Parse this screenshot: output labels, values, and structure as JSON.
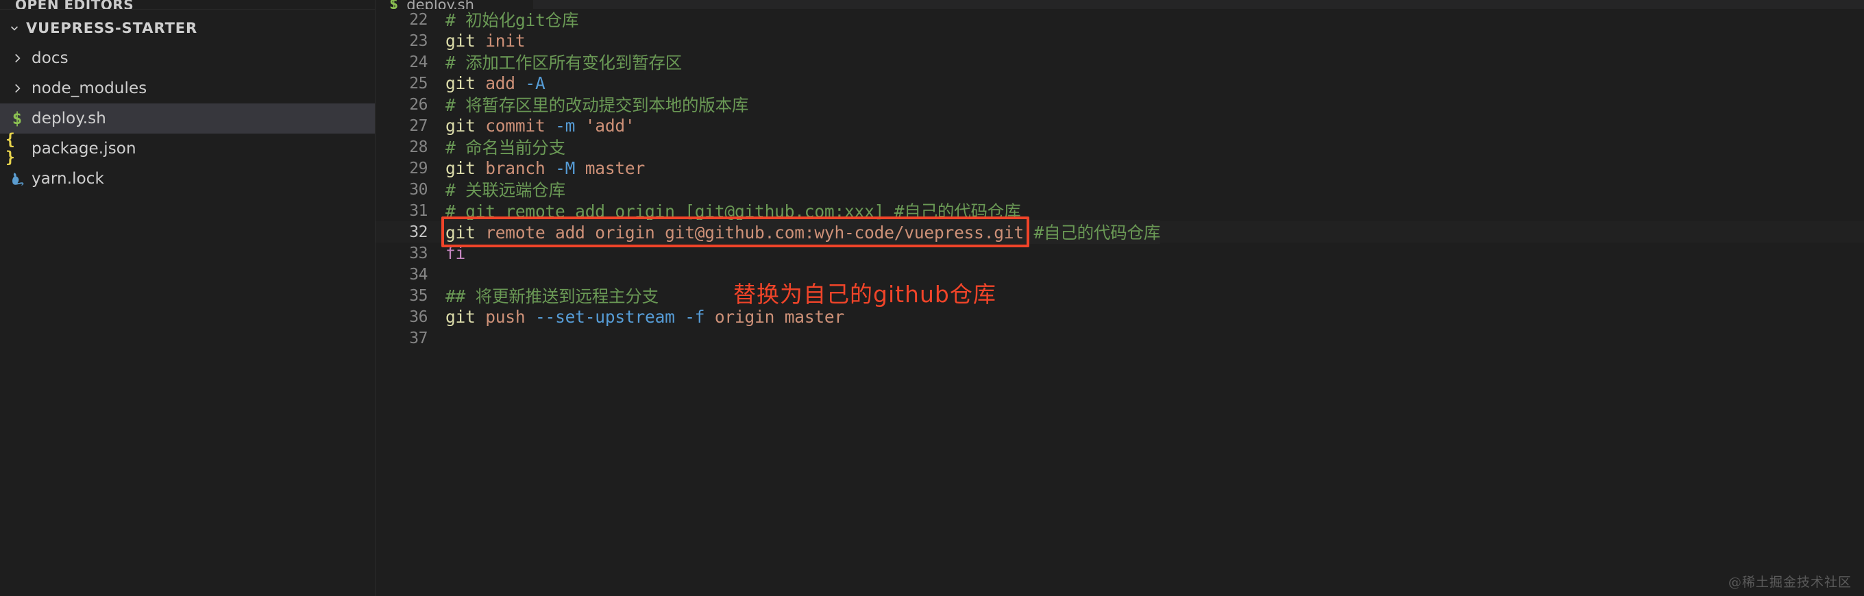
{
  "window": {
    "background": "#1e1e1e",
    "watermark": "@稀土掘金技术社区"
  },
  "sidebar": {
    "open_editors_label": "OPEN EDITORS",
    "root": {
      "label": "VUEPRESS-STARTER",
      "twisty": "chevron-down-icon",
      "expanded": true
    },
    "items": [
      {
        "label": "docs",
        "icon": "chevron-right-icon",
        "kind": "folder",
        "selected": false
      },
      {
        "label": "node_modules",
        "icon": "chevron-right-icon",
        "kind": "folder",
        "selected": false
      },
      {
        "label": "deploy.sh",
        "icon": "shell-file-icon",
        "kind": "file",
        "selected": true,
        "glyph": "$"
      },
      {
        "label": "package.json",
        "icon": "json-file-icon",
        "kind": "file",
        "selected": false,
        "glyph": "{ }"
      },
      {
        "label": "yarn.lock",
        "icon": "yarn-file-icon",
        "kind": "file",
        "selected": false,
        "glyph": ""
      }
    ]
  },
  "editor": {
    "tab": {
      "title": "deploy.sh",
      "icon": "shell-file-icon",
      "glyph": "$",
      "active": true
    },
    "active_line": 32,
    "lines": [
      {
        "n": "22",
        "tokens": [
          {
            "t": "# 初始化git仓库",
            "c": "comment"
          }
        ]
      },
      {
        "n": "23",
        "tokens": [
          {
            "t": "git ",
            "c": "cmd"
          },
          {
            "t": "init",
            "c": "sub"
          }
        ]
      },
      {
        "n": "24",
        "tokens": [
          {
            "t": "# 添加工作区所有变化到暂存区",
            "c": "comment"
          }
        ]
      },
      {
        "n": "25",
        "tokens": [
          {
            "t": "git ",
            "c": "cmd"
          },
          {
            "t": "add ",
            "c": "sub"
          },
          {
            "t": "-A",
            "c": "flag"
          }
        ]
      },
      {
        "n": "26",
        "tokens": [
          {
            "t": "# 将暂存区里的改动提交到本地的版本库",
            "c": "comment"
          }
        ]
      },
      {
        "n": "27",
        "tokens": [
          {
            "t": "git ",
            "c": "cmd"
          },
          {
            "t": "commit ",
            "c": "sub"
          },
          {
            "t": "-m",
            "c": "flag"
          },
          {
            "t": " ",
            "c": "plain"
          },
          {
            "t": "'add'",
            "c": "str"
          }
        ]
      },
      {
        "n": "28",
        "tokens": [
          {
            "t": "# 命名当前分支",
            "c": "comment"
          }
        ]
      },
      {
        "n": "29",
        "tokens": [
          {
            "t": "git ",
            "c": "cmd"
          },
          {
            "t": "branch ",
            "c": "sub"
          },
          {
            "t": "-M",
            "c": "flag"
          },
          {
            "t": " master",
            "c": "sub"
          }
        ]
      },
      {
        "n": "30",
        "tokens": [
          {
            "t": "# 关联远端仓库",
            "c": "comment"
          }
        ]
      },
      {
        "n": "31",
        "tokens": [
          {
            "t": "# git remote add origin [git@github.com:xxx] #自己的代码仓库",
            "c": "comment"
          }
        ]
      },
      {
        "n": "32",
        "highlight": true,
        "tokens": [
          {
            "t": "git ",
            "c": "cmd"
          },
          {
            "t": "remote add origin git@github.com:wyh-code/vuepress.git",
            "c": "sub"
          },
          {
            "t": " ",
            "c": "plain"
          },
          {
            "t": "#自己的代码仓库",
            "c": "comment"
          }
        ]
      },
      {
        "n": "33",
        "tokens": [
          {
            "t": "fi",
            "c": "kw"
          }
        ]
      },
      {
        "n": "34",
        "tokens": [
          {
            "t": "",
            "c": "plain"
          }
        ]
      },
      {
        "n": "35",
        "tokens": [
          {
            "t": "## 将更新推送到远程主分支",
            "c": "comment"
          }
        ]
      },
      {
        "n": "36",
        "tokens": [
          {
            "t": "git ",
            "c": "cmd"
          },
          {
            "t": "push ",
            "c": "sub"
          },
          {
            "t": "--set-upstream -f",
            "c": "flag"
          },
          {
            "t": " origin master",
            "c": "sub"
          }
        ]
      },
      {
        "n": "37",
        "tokens": [
          {
            "t": "",
            "c": "plain"
          }
        ]
      }
    ]
  },
  "annotations": {
    "callout_color": "#f04429",
    "callout_text": "替换为自己的github仓库",
    "box_target_line": "32"
  }
}
